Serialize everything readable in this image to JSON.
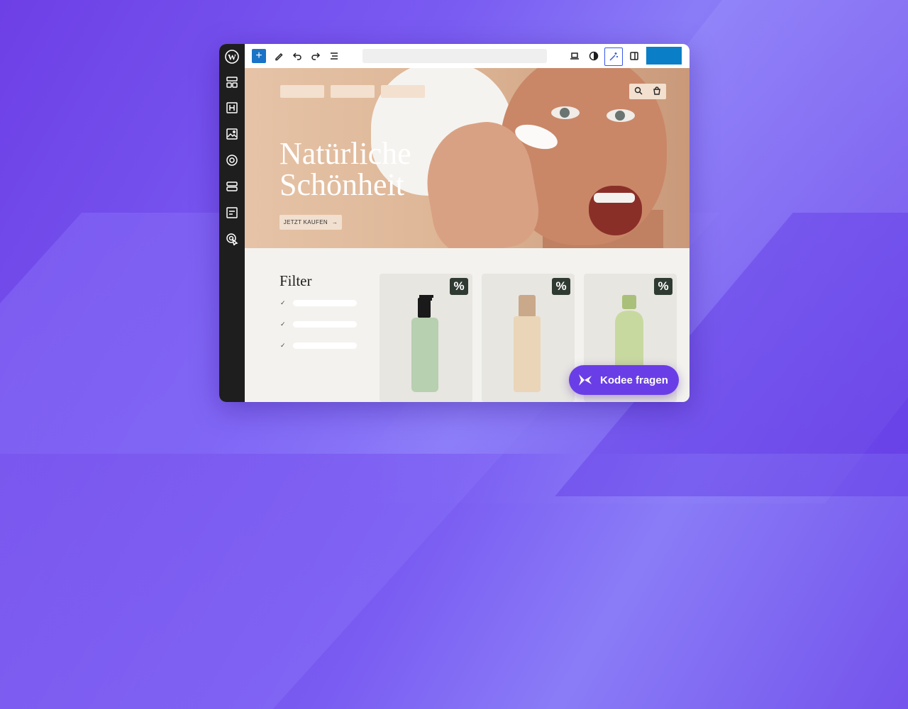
{
  "toolbar": {
    "add_label": "+",
    "icons": [
      "plus-icon",
      "pen-icon",
      "undo-icon",
      "redo-icon",
      "list-view-icon",
      "laptop-icon",
      "contrast-icon",
      "magic-wand-icon",
      "sidebar-toggle-icon"
    ]
  },
  "sidebar": {
    "icons": [
      "wordpress-logo",
      "layout-icon",
      "heading-icon",
      "image-icon",
      "target-icon",
      "blocks-icon",
      "form-icon",
      "cursor-click-icon"
    ]
  },
  "hero": {
    "title_line1": "Natürliche",
    "title_line2": "Schönheit",
    "cta_label": "JETZT KAUFEN",
    "cta_arrow": "→"
  },
  "shop": {
    "filter_title": "Filter",
    "filter_items": [
      "✓",
      "✓",
      "✓"
    ],
    "badge": "%",
    "products": [
      {
        "bottle_color": "#b7d0b0",
        "cap_color": "#1a1a1a"
      },
      {
        "bottle_color": "#ead5b8",
        "cap_color": "#c9a98a"
      },
      {
        "bottle_color": "#c8d9a0",
        "cap_color": "#a9c07a"
      }
    ]
  },
  "kodee": {
    "label": "Kodee fragen"
  },
  "colors": {
    "accent": "#6a3ee6",
    "wp_blue": "#0a7fc8"
  }
}
